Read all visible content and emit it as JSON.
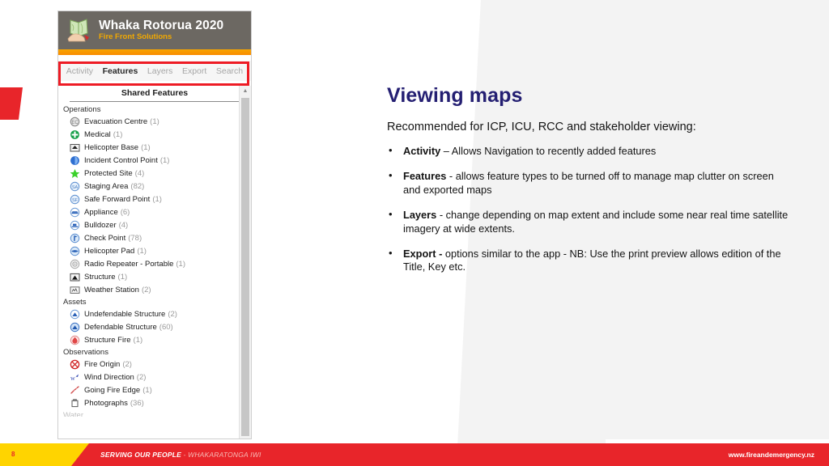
{
  "slide": {
    "page_number": "8"
  },
  "app": {
    "icon": "folded-map-in-hand-icon",
    "title": "Whaka Rotorua 2020",
    "subtitle": "Fire Front Solutions",
    "tabs": [
      {
        "label": "Activity",
        "active": false
      },
      {
        "label": "Features",
        "active": true
      },
      {
        "label": "Layers",
        "active": false
      },
      {
        "label": "Export",
        "active": false
      },
      {
        "label": "Search",
        "active": false
      }
    ],
    "panel_header": "Shared Features",
    "scrollbar": {
      "up_arrow": "▲"
    },
    "groups": [
      {
        "name": "Operations",
        "items": [
          {
            "icon": "evacuation-centre-icon",
            "label": "Evacuation Centre",
            "count": "(1)"
          },
          {
            "icon": "medical-icon",
            "label": "Medical",
            "count": "(1)"
          },
          {
            "icon": "helicopter-base-icon",
            "label": "Helicopter Base",
            "count": "(1)"
          },
          {
            "icon": "incident-control-point-icon",
            "label": "Incident Control Point",
            "count": "(1)"
          },
          {
            "icon": "protected-site-icon",
            "label": "Protected Site",
            "count": "(4)"
          },
          {
            "icon": "staging-area-icon",
            "label": "Staging Area",
            "count": "(82)"
          },
          {
            "icon": "safe-forward-point-icon",
            "label": "Safe Forward Point",
            "count": "(1)"
          },
          {
            "icon": "appliance-icon",
            "label": "Appliance",
            "count": "(6)"
          },
          {
            "icon": "bulldozer-icon",
            "label": "Bulldozer",
            "count": "(4)"
          },
          {
            "icon": "check-point-icon",
            "label": "Check Point",
            "count": "(78)"
          },
          {
            "icon": "helicopter-pad-icon",
            "label": "Helicopter Pad",
            "count": "(1)"
          },
          {
            "icon": "radio-repeater-icon",
            "label": "Radio Repeater - Portable",
            "count": "(1)"
          },
          {
            "icon": "structure-icon",
            "label": "Structure",
            "count": "(1)"
          },
          {
            "icon": "weather-station-icon",
            "label": "Weather Station",
            "count": "(2)"
          }
        ]
      },
      {
        "name": "Assets",
        "items": [
          {
            "icon": "undefendable-structure-icon",
            "label": "Undefendable Structure",
            "count": "(2)"
          },
          {
            "icon": "defendable-structure-icon",
            "label": "Defendable Structure",
            "count": "(60)"
          },
          {
            "icon": "structure-fire-icon",
            "label": "Structure Fire",
            "count": "(1)"
          }
        ]
      },
      {
        "name": "Observations",
        "items": [
          {
            "icon": "fire-origin-icon",
            "label": "Fire Origin",
            "count": "(2)"
          },
          {
            "icon": "wind-direction-icon",
            "label": "Wind Direction",
            "count": "(2)"
          },
          {
            "icon": "going-fire-edge-icon",
            "label": "Going Fire Edge",
            "count": "(1)"
          },
          {
            "icon": "photographs-icon",
            "label": "Photographs",
            "count": "(36)"
          }
        ]
      },
      {
        "name": "Water",
        "clipped": true,
        "items": []
      }
    ]
  },
  "content": {
    "heading": "Viewing maps",
    "intro": "Recommended for ICP,  ICU,  RCC and stakeholder viewing:",
    "bullets": [
      {
        "lead": "Activity",
        "rest": " – Allows Navigation to recently added features"
      },
      {
        "lead": "Features",
        "rest": " -  allows feature types to be turned off to manage map clutter on screen and exported maps"
      },
      {
        "lead": "Layers",
        "rest": " - change depending on map extent and include some near real time satellite imagery at wide extents."
      },
      {
        "lead": "Export -",
        "rest": " options similar to the app - NB: Use the print preview allows edition of the Title, Key etc."
      }
    ]
  },
  "footer": {
    "page_number": "8",
    "tagline_strong": "SERVING OUR PEOPLE",
    "tagline_light": " - WHAKARATONGA IWI",
    "url": "www.fireandemergency.nz"
  },
  "colors": {
    "brand_red": "#e8252a",
    "brand_yellow": "#ffd400",
    "heading_navy": "#241f72",
    "callout_red": "#ee1c25",
    "titlebar_grey": "#6c6862",
    "accent_orange": "#f7a600"
  }
}
